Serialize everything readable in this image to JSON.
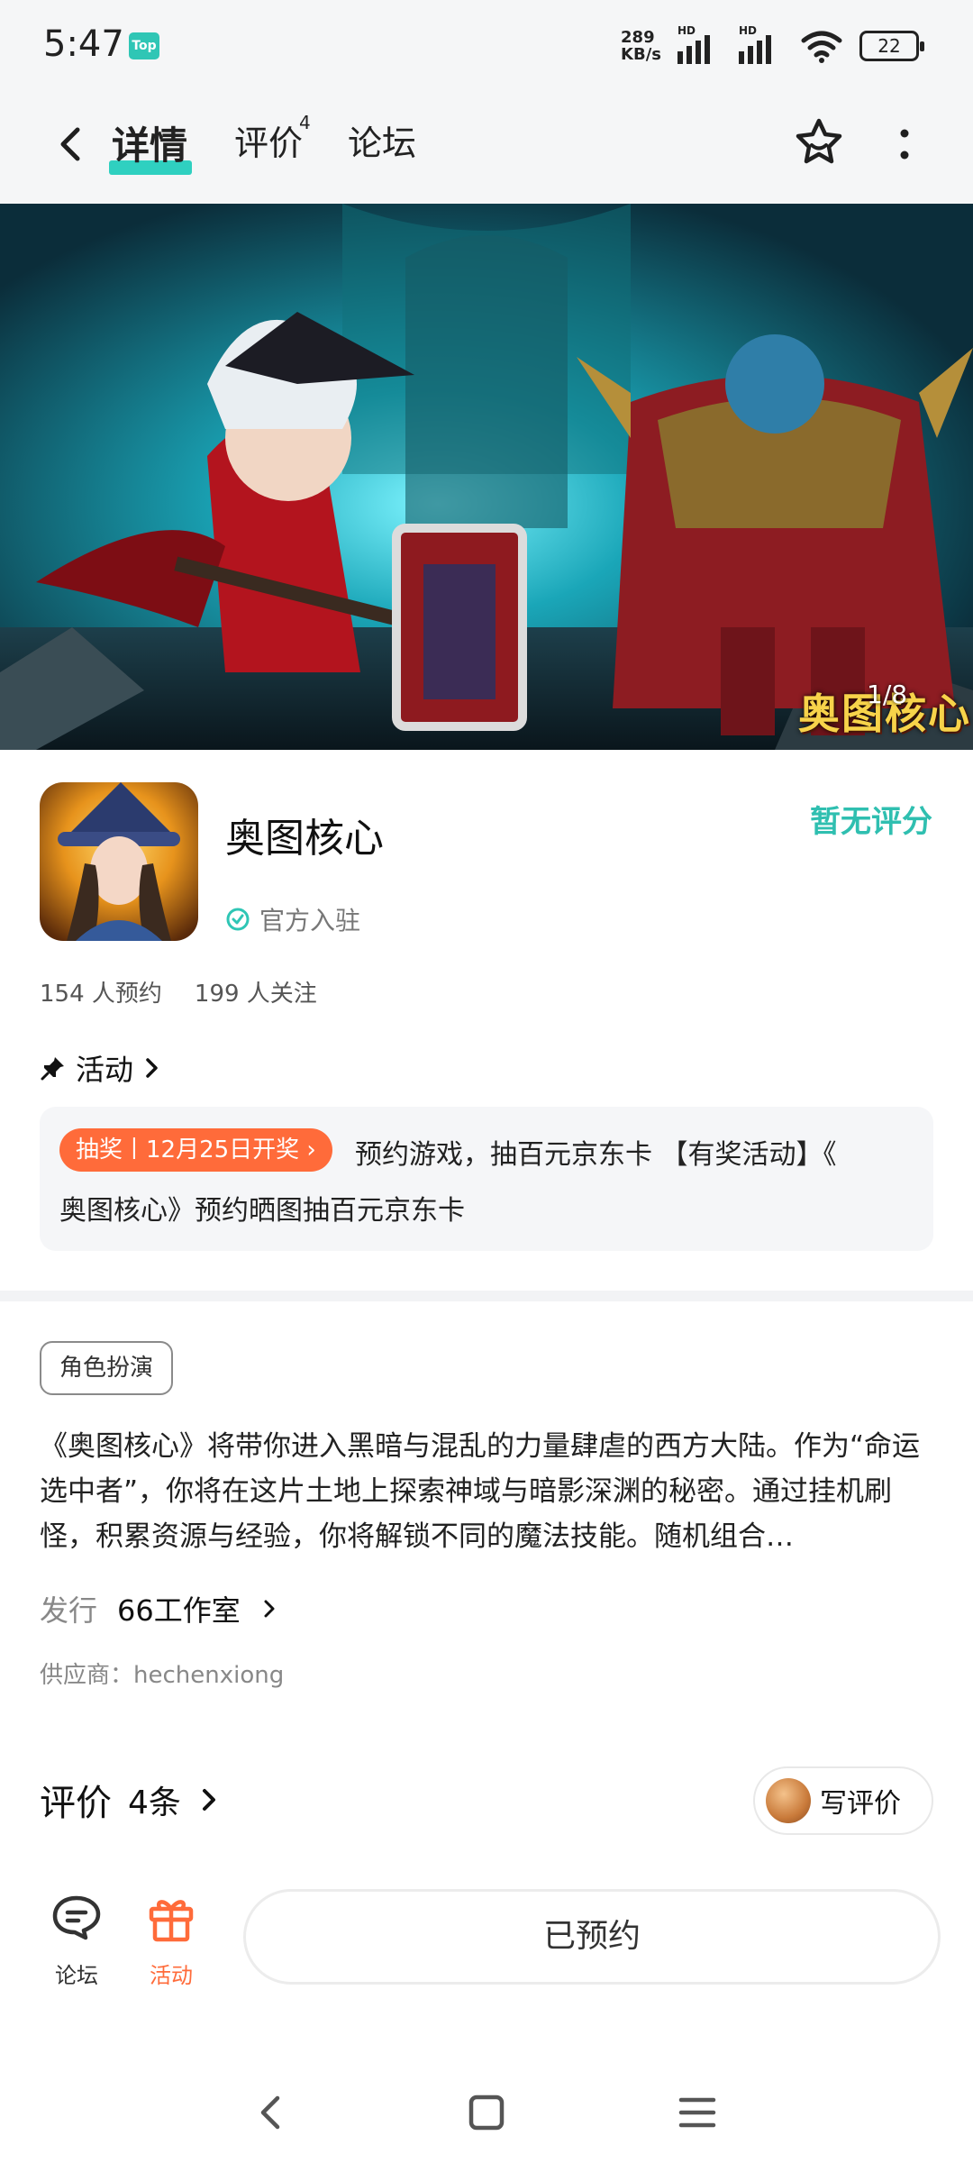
{
  "status_bar": {
    "time": "5:47",
    "badge": "Top",
    "net_speed_value": "289",
    "net_speed_unit": "KB/s",
    "signal1_label": "HD",
    "signal2_label": "HD",
    "battery": "22"
  },
  "nav": {
    "tabs": [
      {
        "label": "详情"
      },
      {
        "label": "评价",
        "sup": "4"
      },
      {
        "label": "论坛"
      }
    ]
  },
  "banner": {
    "logo_text": "奥图核心",
    "counter": "1/8"
  },
  "app": {
    "name": "奥图核心",
    "verified_label": "官方入驻",
    "rating_text": "暂无评分",
    "reservations": "154 人预约",
    "follows": "199 人关注"
  },
  "activity": {
    "heading": "活动",
    "badge": "抽奖丨12月25日开奖 ›",
    "text_line1": "预约游戏，抽百元京东卡 【有奖活动】《",
    "text_line2": "奥图核心》预约晒图抽百元京东卡"
  },
  "details": {
    "genre_tag": "角色扮演",
    "description": "《奥图核心》将带你进入黑暗与混乱的力量肆虐的西方大陆。作为“命运选中者”，你将在这片土地上探索神域与暗影深渊的秘密。通过挂机刷怪，积累资源与经验，你将解锁不同的魔法技能。随机组合…",
    "publisher_label": "发行",
    "publisher_name": "66工作室",
    "supplier": "供应商：hechenxiong"
  },
  "reviews": {
    "title": "评价",
    "count": "4条",
    "write_button": "写评价"
  },
  "bottom_bar": {
    "forum_label": "论坛",
    "activity_label": "活动",
    "reserved_button": "已预约"
  },
  "colors": {
    "accent_teal": "#2fc6b5",
    "accent_orange": "#ff6b3a"
  }
}
